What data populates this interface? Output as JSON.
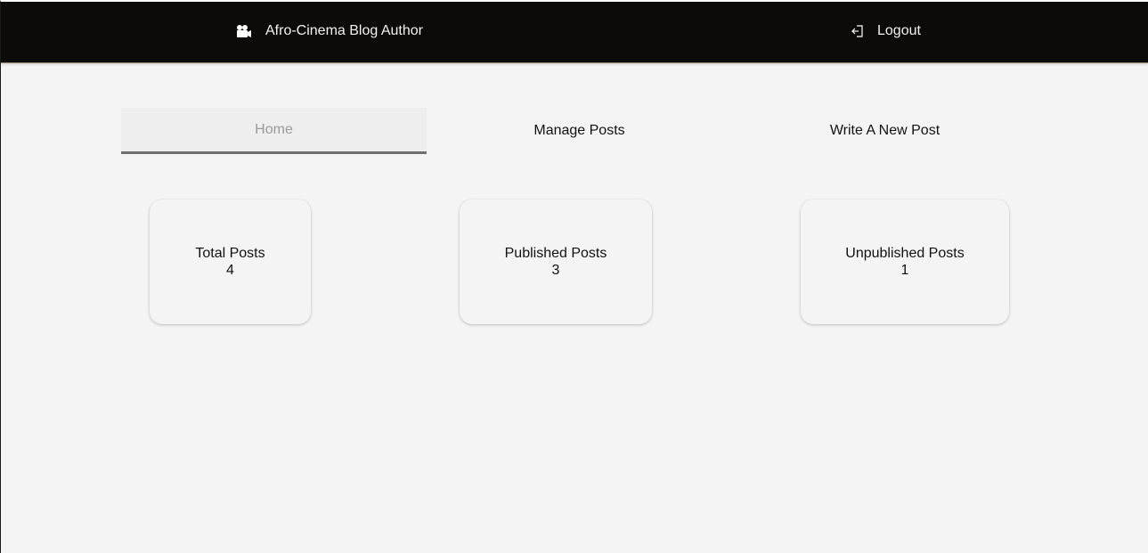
{
  "header": {
    "brand_label": "Afro-Cinema Blog Author",
    "brand_icon": "video-camera-icon",
    "logout_label": "Logout",
    "logout_icon": "sign-out-icon"
  },
  "tabs": [
    {
      "label": "Home",
      "active": true
    },
    {
      "label": "Manage Posts",
      "active": false
    },
    {
      "label": "Write A New Post",
      "active": false
    }
  ],
  "stats": [
    {
      "label": "Total Posts",
      "value": "4"
    },
    {
      "label": "Published Posts",
      "value": "3"
    },
    {
      "label": "Unpublished Posts",
      "value": "1"
    }
  ],
  "colors": {
    "navbar_bg": "#0d0b07",
    "page_bg": "#f4f4f4",
    "active_tab_text": "#9a9a9a",
    "active_tab_indicator": "#6f6f6f"
  }
}
